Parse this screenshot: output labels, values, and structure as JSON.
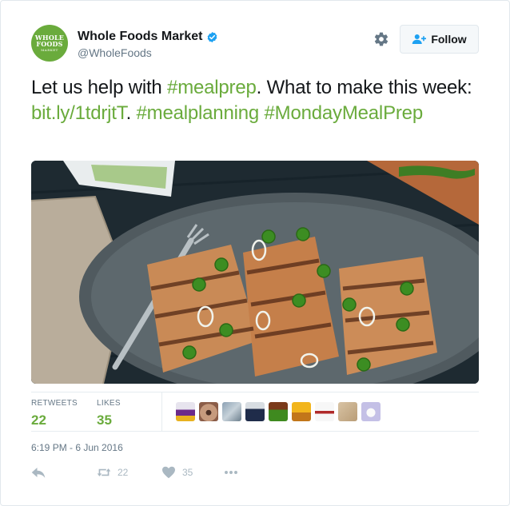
{
  "account": {
    "avatar_line1": "WHOLE",
    "avatar_line2": "FOODS",
    "avatar_line3": "MARKET",
    "name": "Whole Foods Market",
    "handle": "@WholeFoods",
    "verified": true
  },
  "header": {
    "follow_label": "Follow"
  },
  "tweet": {
    "text_1": "Let us help with ",
    "hashtag_1": "#mealprep",
    "text_2": ". What to make this week: ",
    "link": "bit.ly/1tdrjtT",
    "text_3": ". ",
    "hashtag_2": "#mealplanning",
    "hashtag_3": "#MondayMealPrep"
  },
  "stats": {
    "retweets_label": "RETWEETS",
    "retweets_value": "22",
    "likes_label": "LIKES",
    "likes_value": "35"
  },
  "timestamp": "6:19 PM - 6 Jun 2016",
  "actions": {
    "retweet_count": "22",
    "like_count": "35"
  },
  "colors": {
    "brand_green": "#6aab3c",
    "muted": "#657786",
    "icon_muted": "#aab8c2",
    "verified_blue": "#1da1f2"
  },
  "icons": [
    "gear-icon",
    "follow-person-icon",
    "verified-badge-icon",
    "reply-icon",
    "retweet-icon",
    "heart-icon",
    "more-icon"
  ]
}
